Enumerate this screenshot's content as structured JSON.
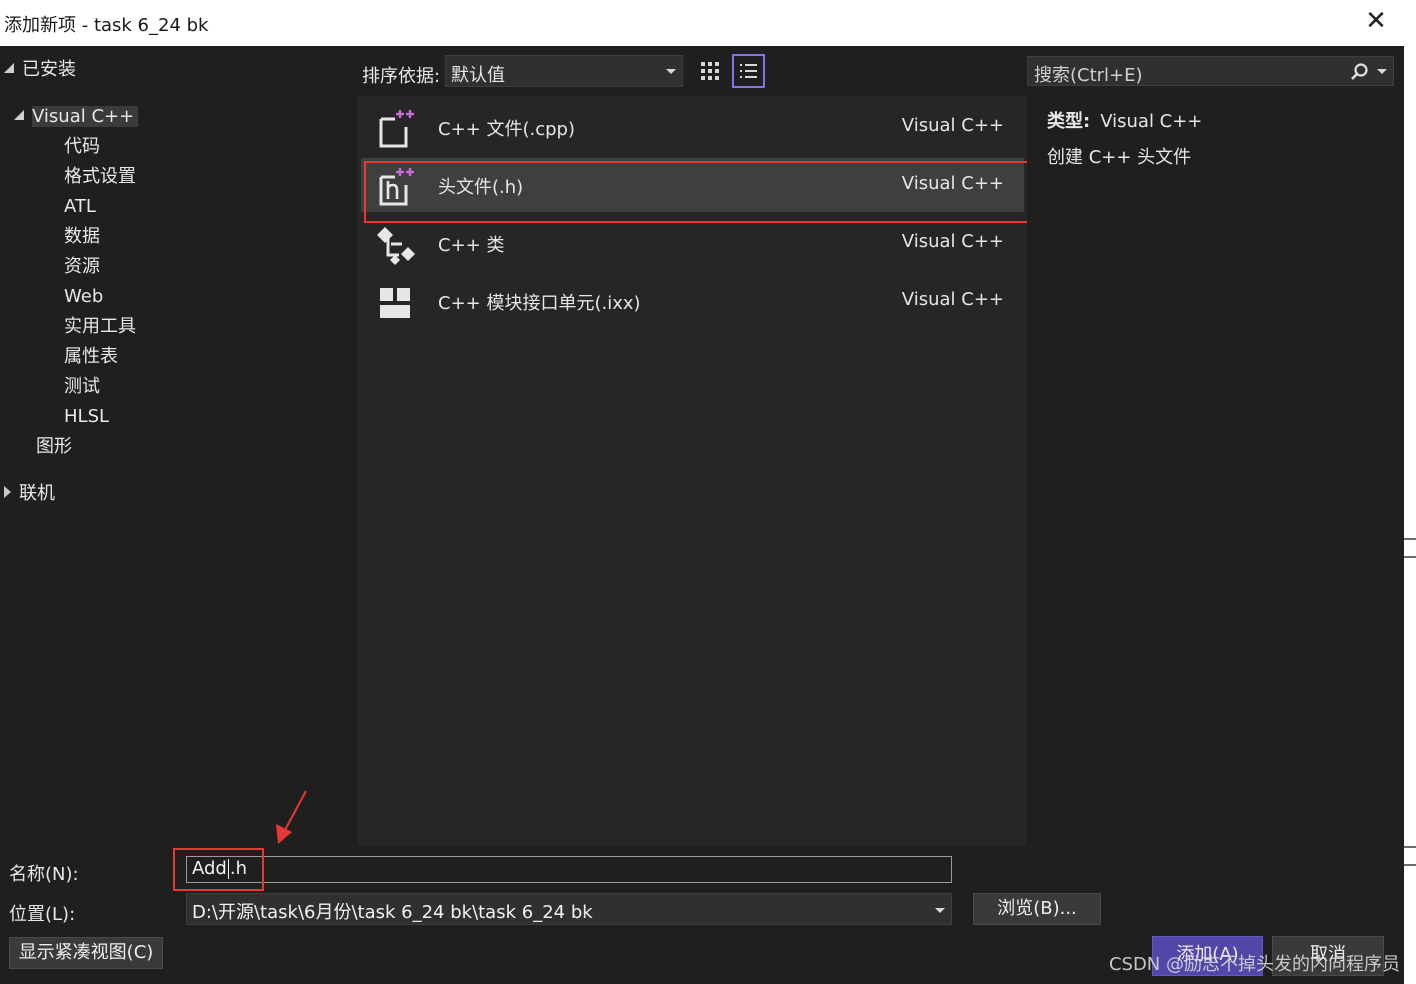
{
  "window": {
    "title": "添加新项 - task 6_24 bk",
    "close_glyph": "✕"
  },
  "left_tree": {
    "installed": "已安装",
    "visual_cpp": "Visual C++",
    "children": [
      "代码",
      "格式设置",
      "ATL",
      "数据",
      "资源",
      "Web",
      "实用工具",
      "属性表",
      "测试",
      "HLSL"
    ],
    "graphics": "图形",
    "online": "联机"
  },
  "toolbar": {
    "sort_label": "排序依据:",
    "sort_value": "默认值",
    "search_placeholder": "搜索(Ctrl+E)",
    "views": [
      "grid-view",
      "list-view"
    ]
  },
  "templates": [
    {
      "name": "C++ 文件(.cpp)",
      "type": "Visual C++",
      "icon": "cpp-file-icon"
    },
    {
      "name": "头文件(.h)",
      "type": "Visual C++",
      "icon": "header-file-icon",
      "selected": true
    },
    {
      "name": "C++ 类",
      "type": "Visual C++",
      "icon": "cpp-class-icon"
    },
    {
      "name": "C++ 模块接口单元(.ixx)",
      "type": "Visual C++",
      "icon": "module-icon"
    }
  ],
  "details": {
    "type_label": "类型:",
    "type_value": "Visual C++",
    "description": "创建 C++ 头文件"
  },
  "form": {
    "name_label": "名称(N):",
    "name_value_before": "Add",
    "name_value_after": ".h",
    "location_label": "位置(L):",
    "location_value": "D:\\开源\\task\\6月份\\task 6_24 bk\\task 6_24 bk",
    "browse": "浏览(B)...",
    "compact_view": "显示紧凑视图(C)",
    "add": "添加(A)",
    "cancel": "取消"
  },
  "watermark": "CSDN @励志不掉头发的内向程序员",
  "colors": {
    "accent": "#8a70e8",
    "highlight": "#e53935",
    "primary_button": "#5246a8",
    "icon_plus": "#c86dd7"
  }
}
